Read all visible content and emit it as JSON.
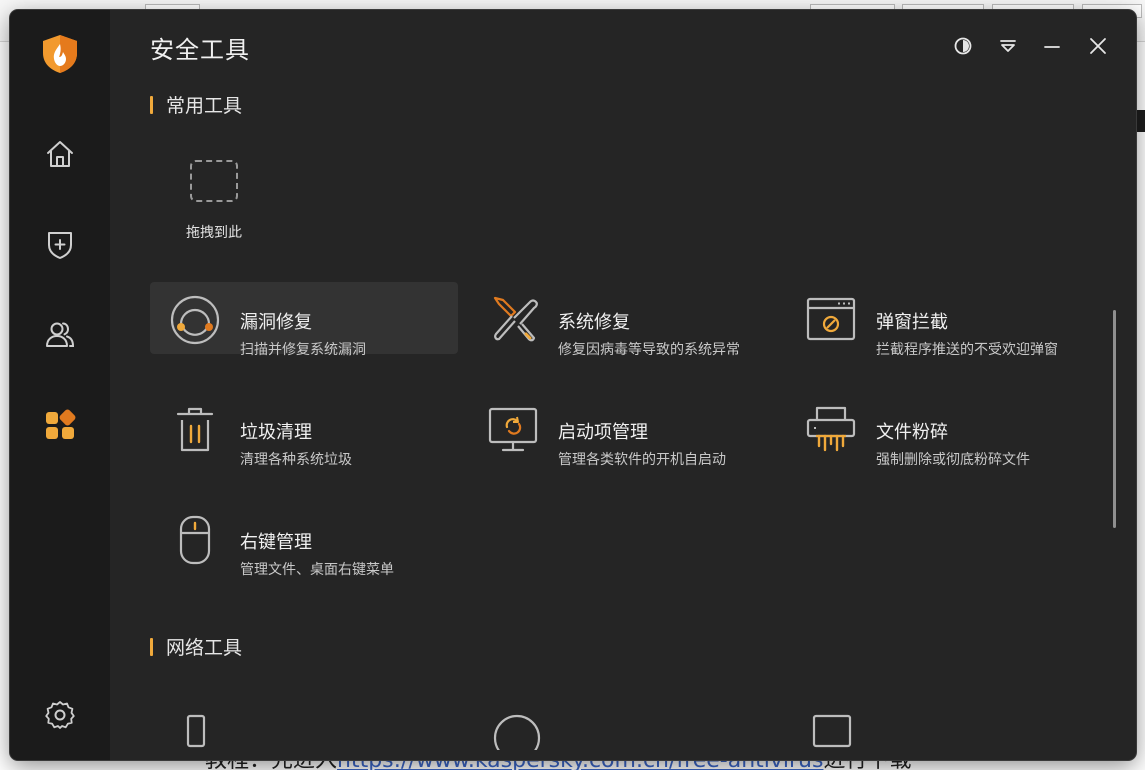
{
  "window": {
    "title": "安全工具"
  },
  "sections": {
    "common": "常用工具",
    "network": "网络工具"
  },
  "drop_slot": {
    "label": "拖拽到此"
  },
  "tools": [
    {
      "id": "vuln",
      "name": "漏洞修复",
      "desc": "扫描并修复系统漏洞",
      "icon": "vulnerability-fix-icon"
    },
    {
      "id": "sysfix",
      "name": "系统修复",
      "desc": "修复因病毒等导致的系统异常",
      "icon": "wrench-screwdriver-icon"
    },
    {
      "id": "popup",
      "name": "弹窗拦截",
      "desc": "拦截程序推送的不受欢迎弹窗",
      "icon": "popup-block-icon"
    },
    {
      "id": "junk",
      "name": "垃圾清理",
      "desc": "清理各种系统垃圾",
      "icon": "trash-icon"
    },
    {
      "id": "startup",
      "name": "启动项管理",
      "desc": "管理各类软件的开机自启动",
      "icon": "monitor-refresh-icon"
    },
    {
      "id": "shred",
      "name": "文件粉碎",
      "desc": "强制删除或彻底粉碎文件",
      "icon": "shredder-icon"
    },
    {
      "id": "context",
      "name": "右键管理",
      "desc": "管理文件、桌面右键菜单",
      "icon": "mouse-icon"
    }
  ],
  "sidebar": {
    "items": [
      {
        "icon": "home-icon"
      },
      {
        "icon": "shield-plus-icon"
      },
      {
        "icon": "users-icon"
      },
      {
        "icon": "tools-grid-icon",
        "active": true
      },
      {
        "icon": "settings-icon"
      }
    ]
  },
  "background_doc": {
    "prefix": "教程：先进入",
    "link": "https://www.kaspersky.com.cn/free-antivirus",
    "suffix": "进行下载"
  },
  "colors": {
    "accent": "#f0a93b",
    "accent_dark": "#e07a1f",
    "window_bg": "#252525",
    "sidebar_bg": "#1b1b1b",
    "active_card": "#333333"
  }
}
